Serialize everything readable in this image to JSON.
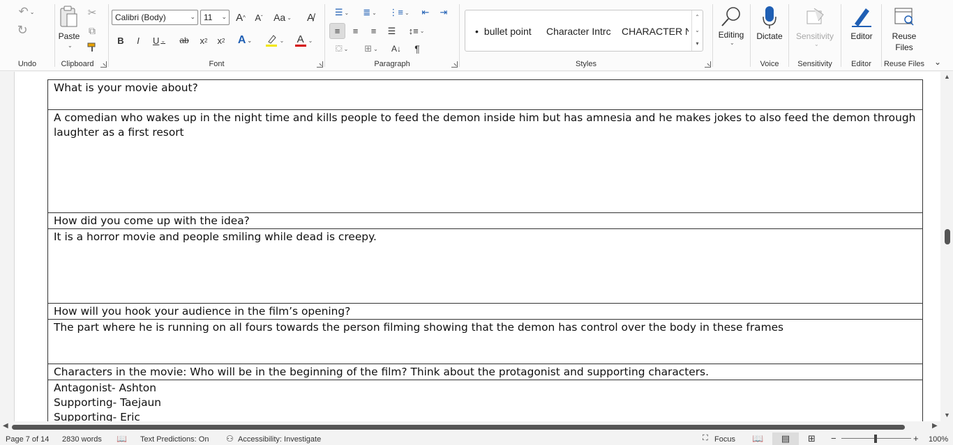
{
  "ribbon": {
    "undo": {
      "group_label": "Undo"
    },
    "clipboard": {
      "group_label": "Clipboard",
      "paste_label": "Paste"
    },
    "font": {
      "group_label": "Font",
      "font_name": "Calibri (Body)",
      "font_size": "11",
      "grow_label": "A",
      "shrink_label": "A",
      "change_case_label": "Aa",
      "bold": "B",
      "italic": "I",
      "underline": "U",
      "strikethrough": "ab",
      "subscript": "x",
      "superscript": "x",
      "text_effects": "A",
      "font_color": "A"
    },
    "paragraph": {
      "group_label": "Paragraph",
      "pilcrow": "¶"
    },
    "styles": {
      "group_label": "Styles",
      "items": [
        "bullet point",
        "Character Intrc",
        "CHARACTER N"
      ]
    },
    "editing": {
      "label": "Editing"
    },
    "voice": {
      "group_label": "Voice",
      "dictate_label": "Dictate"
    },
    "sensitivity": {
      "group_label": "Sensitivity",
      "button_label": "Sensitivity"
    },
    "editor": {
      "group_label": "Editor",
      "button_label": "Editor"
    },
    "reuse_files": {
      "group_label": "Reuse Files",
      "button_label_1": "Reuse",
      "button_label_2": "Files"
    }
  },
  "document": {
    "rows": [
      "What is your movie about?",
      "A comedian who wakes up in the night time and kills people to feed the demon inside him but has amnesia and he makes jokes to also feed the demon through laughter as a first resort",
      "How did you come up with the idea?",
      "It is a horror movie and people smiling while dead is creepy.",
      "How will you hook your audience in the film’s opening?",
      "The part where he is running on all fours towards the person filming showing that the demon has control over the body in these frames",
      "Characters in the movie: Who will be in the beginning of the film? Think about the protagonist and supporting characters.",
      "Antagonist- Ashton",
      "Supporting- Taejaun",
      "Supporting- Eric"
    ]
  },
  "status": {
    "page": "Page 7 of 14",
    "words": "2830 words",
    "text_predictions": "Text Predictions: On",
    "accessibility": "Accessibility: Investigate",
    "focus": "Focus",
    "zoom": "100%"
  },
  "colors": {
    "highlight": "#f2e600",
    "font_color": "#d40000",
    "accent": "#1f5fb4"
  }
}
